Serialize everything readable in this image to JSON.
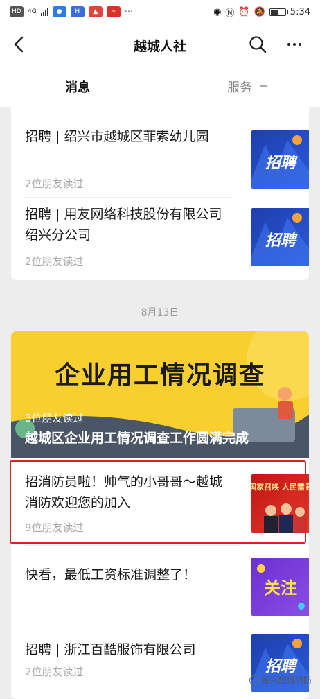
{
  "status_bar": {
    "network": "HD",
    "signal": "4G",
    "time": "5:34",
    "battery_level": 0.55
  },
  "header": {
    "title": "越城人社"
  },
  "tabs": [
    {
      "label": "消息",
      "active": true
    },
    {
      "label": "服务",
      "active": false
    }
  ],
  "articles_top": [
    {
      "title": "招聘 | 绍兴市越城区菲索幼儿园",
      "meta": "2位朋友读过",
      "thumb_text": "招聘"
    },
    {
      "title": "招聘 | 用友网络科技股份有限公司绍兴分公司",
      "meta": "2位朋友读过",
      "thumb_text": "招聘"
    }
  ],
  "date_label": "8月13日",
  "banner": {
    "heading": "企业用工情况调查",
    "meta": "3位朋友读过",
    "title": "越城区企业用工情况调查工作圆满完成"
  },
  "articles_bottom": [
    {
      "title": "招消防员啦！帅气的小哥哥～越城消防欢迎您的加入",
      "meta": "9位朋友读过",
      "thumb_text": "国家召唤 人民需要"
    },
    {
      "title": "快看，最低工资标准调整了！",
      "meta": "",
      "thumb_text": "关注"
    },
    {
      "title": "招聘 | 浙江百酷服饰有限公司",
      "meta": "2位朋友读过",
      "thumb_text": "招聘"
    }
  ],
  "watermark": "绍兴越城消防",
  "colors": {
    "accent_red": "#e02020",
    "banner_yellow": "#f8cf2e",
    "thumb_blue": "#2b59d9",
    "thumb_purple": "#7a3fd6"
  }
}
